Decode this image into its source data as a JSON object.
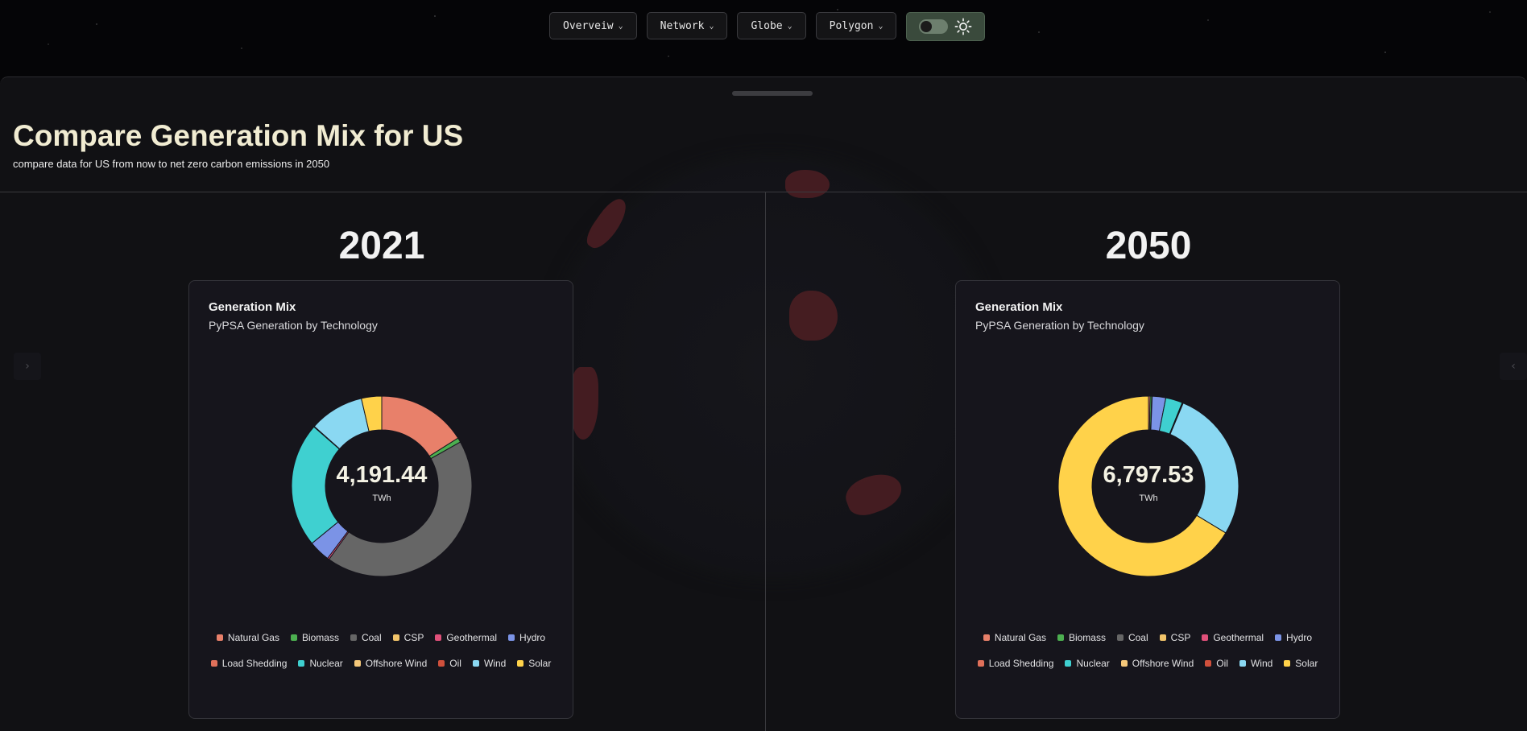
{
  "nav": {
    "items": [
      {
        "label": "Overveiw",
        "icon": "chevron-down-icon"
      },
      {
        "label": "Network",
        "icon": "chevron-down-icon"
      },
      {
        "label": "Globe",
        "icon": "chevron-down-icon"
      },
      {
        "label": "Polygon",
        "icon": "chevron-down-icon"
      }
    ],
    "theme_toggle": {
      "icon": "sun-icon",
      "state": "off",
      "accent": "#3a4a3c"
    }
  },
  "header": {
    "title": "Compare Generation Mix for US",
    "subtitle": "compare data for US from now to net zero carbon emissions in 2050"
  },
  "legend_items": [
    {
      "label": "Natural Gas",
      "color": "#e8806a"
    },
    {
      "label": "Biomass",
      "color": "#4caf50"
    },
    {
      "label": "Coal",
      "color": "#666666"
    },
    {
      "label": "CSP",
      "color": "#f2c46a"
    },
    {
      "label": "Geothermal",
      "color": "#e0507a"
    },
    {
      "label": "Hydro",
      "color": "#7b93e6"
    },
    {
      "label": "Load Shedding",
      "color": "#e0705a"
    },
    {
      "label": "Nuclear",
      "color": "#3fd0d0"
    },
    {
      "label": "Offshore Wind",
      "color": "#f5c87a"
    },
    {
      "label": "Oil",
      "color": "#d0503c"
    },
    {
      "label": "Wind",
      "color": "#8ad8f2"
    },
    {
      "label": "Solar",
      "color": "#ffd24a"
    }
  ],
  "panels": [
    {
      "year": "2021",
      "card_title": "Generation Mix",
      "card_subtitle": "PyPSA Generation by Technology",
      "center_value": "4,191.44",
      "center_unit": "TWh"
    },
    {
      "year": "2050",
      "card_title": "Generation Mix",
      "card_subtitle": "PyPSA Generation by Technology",
      "center_value": "6,797.53",
      "center_unit": "TWh"
    }
  ],
  "chart_data": [
    {
      "type": "pie",
      "title": "Generation Mix",
      "subtitle": "PyPSA Generation by Technology",
      "total": "4,191.44",
      "unit": "TWh",
      "categories": [
        "Natural Gas",
        "Biomass",
        "Coal",
        "CSP",
        "Geothermal",
        "Hydro",
        "Load Shedding",
        "Nuclear",
        "Offshore Wind",
        "Oil",
        "Wind",
        "Solar"
      ],
      "values": [
        670,
        34,
        1802,
        0,
        13,
        160,
        0,
        935,
        0,
        4,
        410,
        152
      ],
      "colors": [
        "#e8806a",
        "#4caf50",
        "#666666",
        "#f2c46a",
        "#e0507a",
        "#7b93e6",
        "#e0705a",
        "#3fd0d0",
        "#f5c87a",
        "#d0503c",
        "#8ad8f2",
        "#ffd24a"
      ]
    },
    {
      "type": "pie",
      "title": "Generation Mix",
      "subtitle": "PyPSA Generation by Technology",
      "total": "6,797.53",
      "unit": "TWh",
      "categories": [
        "Natural Gas",
        "Biomass",
        "Coal",
        "CSP",
        "Geothermal",
        "Hydro",
        "Load Shedding",
        "Nuclear",
        "Offshore Wind",
        "Oil",
        "Wind",
        "Solar"
      ],
      "values": [
        20,
        20,
        0,
        0,
        5,
        165,
        0,
        205,
        10,
        3,
        1860,
        4510
      ],
      "colors": [
        "#e8806a",
        "#4caf50",
        "#666666",
        "#f2c46a",
        "#e0507a",
        "#7b93e6",
        "#e0705a",
        "#3fd0d0",
        "#f5c87a",
        "#d0503c",
        "#8ad8f2",
        "#ffd24a"
      ]
    }
  ]
}
